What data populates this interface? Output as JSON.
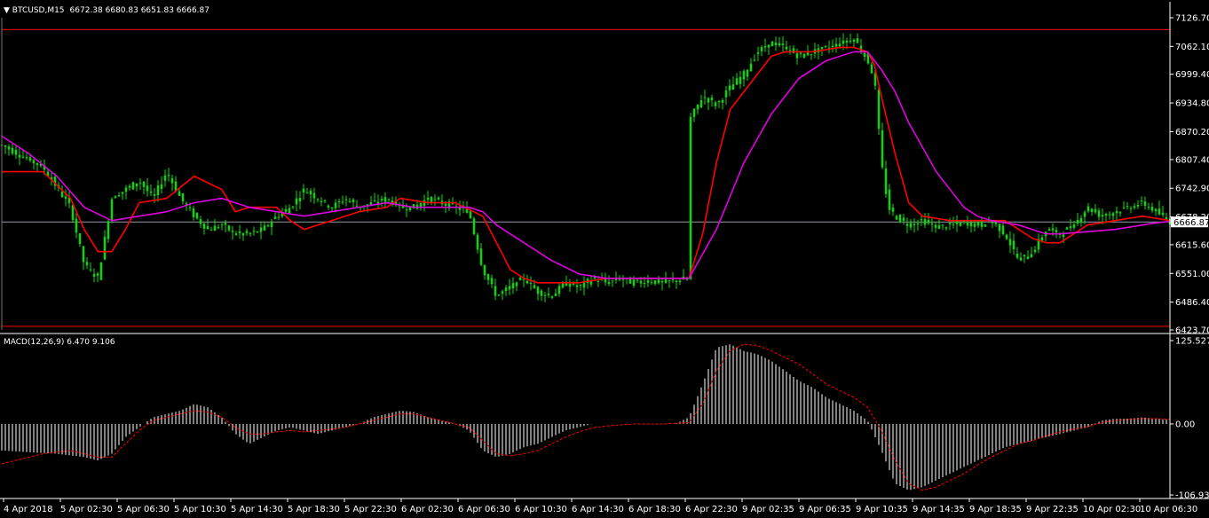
{
  "header": {
    "symbol": "BTCUSD,M15",
    "ohlc": "6672.38 6680.83 6651.83 6666.87"
  },
  "macd_header": "MACD(12,26,9) 6.470 9.106",
  "current_price_label": "6666.87",
  "colors": {
    "background": "#000000",
    "candles": "#00e000",
    "ma_fast": "#ff0000",
    "ma_slow": "#e000e0",
    "hline": "#ff0000",
    "current_line": "#9a9aa8",
    "macd_hist": "#ffffff",
    "macd_signal": "#ff0000",
    "axis_text": "#ffffff"
  },
  "chart_data": [
    {
      "type": "candlestick",
      "title": "BTCUSD,M15",
      "y_ticks": [
        "7126.70",
        "7062.10",
        "6999.40",
        "6934.80",
        "6870.20",
        "6807.40",
        "6742.90",
        "6678.20",
        "6615.60",
        "6551.00",
        "6486.40",
        "6423.70"
      ],
      "ylim": [
        6423.7,
        7126.7
      ],
      "last_price": 6666.87,
      "horizontal_levels": [
        7100,
        6432
      ],
      "x_ticks": [
        "4 Apr 2018",
        "5 Apr 02:30",
        "5 Apr 06:30",
        "5 Apr 10:30",
        "5 Apr 14:30",
        "5 Apr 18:30",
        "5 Apr 22:30",
        "6 Apr 02:30",
        "6 Apr 06:30",
        "6 Apr 10:30",
        "6 Apr 14:30",
        "6 Apr 18:30",
        "6 Apr 22:30",
        "9 Apr 02:35",
        "9 Apr 06:35",
        "9 Apr 10:35",
        "9 Apr 14:35",
        "9 Apr 18:35",
        "9 Apr 22:35",
        "10 Apr 02:30",
        "10 Apr 06:30"
      ],
      "price_path": [
        [
          0,
          6840
        ],
        [
          3,
          6790
        ],
        [
          5,
          6700
        ],
        [
          6,
          6570
        ],
        [
          7,
          6540
        ],
        [
          8,
          6720
        ],
        [
          9,
          6740
        ],
        [
          10,
          6760
        ],
        [
          11,
          6720
        ],
        [
          12,
          6780
        ],
        [
          13,
          6720
        ],
        [
          14,
          6680
        ],
        [
          15,
          6650
        ],
        [
          16,
          6660
        ],
        [
          17,
          6640
        ],
        [
          18,
          6640
        ],
        [
          19,
          6650
        ],
        [
          20,
          6680
        ],
        [
          21,
          6700
        ],
        [
          22,
          6740
        ],
        [
          23,
          6720
        ],
        [
          24,
          6700
        ],
        [
          25,
          6720
        ],
        [
          26,
          6700
        ],
        [
          27,
          6710
        ],
        [
          28,
          6720
        ],
        [
          29,
          6700
        ],
        [
          30,
          6700
        ],
        [
          31,
          6720
        ],
        [
          32,
          6710
        ],
        [
          33,
          6700
        ],
        [
          34,
          6690
        ],
        [
          35,
          6560
        ],
        [
          36,
          6500
        ],
        [
          37,
          6520
        ],
        [
          38,
          6540
        ],
        [
          39,
          6510
        ],
        [
          40,
          6500
        ],
        [
          41,
          6530
        ],
        [
          42,
          6520
        ],
        [
          43,
          6540
        ],
        [
          44,
          6530
        ],
        [
          45,
          6540
        ],
        [
          46,
          6530
        ],
        [
          47,
          6535
        ],
        [
          48,
          6530
        ],
        [
          49,
          6535
        ],
        [
          50,
          6540
        ],
        [
          50.1,
          6900
        ],
        [
          51,
          6950
        ],
        [
          52,
          6930
        ],
        [
          53,
          6970
        ],
        [
          54,
          7000
        ],
        [
          55,
          7050
        ],
        [
          56,
          7070
        ],
        [
          57,
          7060
        ],
        [
          58,
          7040
        ],
        [
          59,
          7050
        ],
        [
          60,
          7060
        ],
        [
          61,
          7070
        ],
        [
          62,
          7080
        ],
        [
          63,
          7030
        ],
        [
          63.5,
          6990
        ],
        [
          64,
          6800
        ],
        [
          64.5,
          6700
        ],
        [
          65,
          6680
        ],
        [
          66,
          6660
        ],
        [
          67,
          6670
        ],
        [
          68,
          6655
        ],
        [
          69,
          6660
        ],
        [
          70,
          6665
        ],
        [
          71,
          6660
        ],
        [
          72,
          6670
        ],
        [
          73,
          6640
        ],
        [
          74,
          6580
        ],
        [
          75,
          6600
        ],
        [
          76,
          6650
        ],
        [
          77,
          6640
        ],
        [
          78,
          6660
        ],
        [
          79,
          6700
        ],
        [
          80,
          6680
        ],
        [
          81,
          6690
        ],
        [
          82,
          6700
        ],
        [
          83,
          6710
        ],
        [
          84,
          6690
        ],
        [
          85,
          6667
        ]
      ],
      "ma_fast": [
        [
          0,
          6780
        ],
        [
          3,
          6780
        ],
        [
          5,
          6720
        ],
        [
          6,
          6650
        ],
        [
          7,
          6600
        ],
        [
          8,
          6600
        ],
        [
          9,
          6650
        ],
        [
          10,
          6710
        ],
        [
          12,
          6720
        ],
        [
          14,
          6770
        ],
        [
          16,
          6740
        ],
        [
          17,
          6690
        ],
        [
          18,
          6700
        ],
        [
          20,
          6700
        ],
        [
          21,
          6670
        ],
        [
          22,
          6650
        ],
        [
          24,
          6670
        ],
        [
          26,
          6690
        ],
        [
          28,
          6700
        ],
        [
          29,
          6720
        ],
        [
          31,
          6710
        ],
        [
          33,
          6710
        ],
        [
          35,
          6680
        ],
        [
          36,
          6620
        ],
        [
          37,
          6560
        ],
        [
          38,
          6540
        ],
        [
          39,
          6530
        ],
        [
          40,
          6530
        ],
        [
          42,
          6530
        ],
        [
          44,
          6540
        ],
        [
          46,
          6540
        ],
        [
          48,
          6540
        ],
        [
          50,
          6540
        ],
        [
          51,
          6640
        ],
        [
          52,
          6800
        ],
        [
          53,
          6920
        ],
        [
          54,
          6960
        ],
        [
          55,
          7000
        ],
        [
          56,
          7040
        ],
        [
          57,
          7050
        ],
        [
          59,
          7050
        ],
        [
          61,
          7060
        ],
        [
          62,
          7060
        ],
        [
          63,
          7050
        ],
        [
          63.5,
          7020
        ],
        [
          64,
          6950
        ],
        [
          65,
          6820
        ],
        [
          66,
          6710
        ],
        [
          67,
          6680
        ],
        [
          69,
          6670
        ],
        [
          71,
          6670
        ],
        [
          73,
          6670
        ],
        [
          74,
          6650
        ],
        [
          75,
          6630
        ],
        [
          76,
          6620
        ],
        [
          77,
          6620
        ],
        [
          78,
          6640
        ],
        [
          79,
          6660
        ],
        [
          81,
          6670
        ],
        [
          83,
          6680
        ],
        [
          85,
          6670
        ]
      ],
      "ma_slow": [
        [
          0,
          6860
        ],
        [
          2,
          6820
        ],
        [
          4,
          6770
        ],
        [
          6,
          6700
        ],
        [
          8,
          6670
        ],
        [
          10,
          6680
        ],
        [
          12,
          6690
        ],
        [
          14,
          6710
        ],
        [
          16,
          6720
        ],
        [
          18,
          6700
        ],
        [
          20,
          6690
        ],
        [
          22,
          6680
        ],
        [
          24,
          6690
        ],
        [
          26,
          6700
        ],
        [
          28,
          6710
        ],
        [
          30,
          6700
        ],
        [
          32,
          6700
        ],
        [
          34,
          6700
        ],
        [
          35,
          6690
        ],
        [
          36,
          6660
        ],
        [
          38,
          6620
        ],
        [
          40,
          6580
        ],
        [
          42,
          6550
        ],
        [
          44,
          6540
        ],
        [
          46,
          6540
        ],
        [
          48,
          6540
        ],
        [
          50,
          6540
        ],
        [
          52,
          6650
        ],
        [
          54,
          6800
        ],
        [
          56,
          6910
        ],
        [
          58,
          6990
        ],
        [
          60,
          7030
        ],
        [
          62,
          7050
        ],
        [
          63,
          7050
        ],
        [
          64,
          7010
        ],
        [
          65,
          6960
        ],
        [
          66,
          6890
        ],
        [
          68,
          6780
        ],
        [
          70,
          6700
        ],
        [
          71,
          6680
        ],
        [
          72,
          6670
        ],
        [
          73,
          6665
        ],
        [
          74,
          6660
        ],
        [
          75,
          6650
        ],
        [
          76,
          6640
        ],
        [
          77,
          6640
        ],
        [
          79,
          6645
        ],
        [
          81,
          6650
        ],
        [
          83,
          6660
        ],
        [
          84,
          6665
        ],
        [
          85,
          6668
        ]
      ]
    },
    {
      "type": "bar",
      "title": "MACD(12,26,9)",
      "y_ticks": [
        "125.527",
        "0.00",
        "-106.938"
      ],
      "ylim": [
        -106.938,
        125.527
      ],
      "histogram": [
        [
          0,
          -40
        ],
        [
          4,
          -45
        ],
        [
          6,
          -50
        ],
        [
          7,
          -55
        ],
        [
          8,
          -45
        ],
        [
          9,
          -20
        ],
        [
          10,
          -5
        ],
        [
          11,
          10
        ],
        [
          12,
          15
        ],
        [
          13,
          20
        ],
        [
          14,
          30
        ],
        [
          15,
          25
        ],
        [
          16,
          10
        ],
        [
          17,
          -15
        ],
        [
          18,
          -30
        ],
        [
          19,
          -20
        ],
        [
          20,
          -10
        ],
        [
          21,
          -5
        ],
        [
          22,
          -10
        ],
        [
          23,
          -15
        ],
        [
          24,
          -10
        ],
        [
          25,
          -5
        ],
        [
          26,
          0
        ],
        [
          27,
          10
        ],
        [
          28,
          15
        ],
        [
          29,
          20
        ],
        [
          30,
          18
        ],
        [
          31,
          10
        ],
        [
          32,
          5
        ],
        [
          33,
          0
        ],
        [
          34,
          -10
        ],
        [
          35,
          -40
        ],
        [
          36,
          -50
        ],
        [
          37,
          -45
        ],
        [
          38,
          -35
        ],
        [
          39,
          -30
        ],
        [
          40,
          -20
        ],
        [
          41,
          -10
        ],
        [
          42,
          -5
        ],
        [
          43,
          0
        ],
        [
          44,
          0
        ],
        [
          45,
          0
        ],
        [
          46,
          0
        ],
        [
          47,
          0
        ],
        [
          48,
          0
        ],
        [
          49,
          0
        ],
        [
          50,
          10
        ],
        [
          51,
          60
        ],
        [
          52,
          115
        ],
        [
          53,
          120
        ],
        [
          54,
          110
        ],
        [
          55,
          105
        ],
        [
          56,
          95
        ],
        [
          57,
          80
        ],
        [
          58,
          65
        ],
        [
          59,
          55
        ],
        [
          60,
          40
        ],
        [
          61,
          30
        ],
        [
          62,
          20
        ],
        [
          63,
          5
        ],
        [
          64,
          -40
        ],
        [
          65,
          -90
        ],
        [
          66,
          -100
        ],
        [
          67,
          -95
        ],
        [
          68,
          -85
        ],
        [
          69,
          -75
        ],
        [
          70,
          -65
        ],
        [
          71,
          -55
        ],
        [
          72,
          -45
        ],
        [
          73,
          -35
        ],
        [
          74,
          -30
        ],
        [
          75,
          -25
        ],
        [
          76,
          -20
        ],
        [
          77,
          -15
        ],
        [
          78,
          -10
        ],
        [
          79,
          -5
        ],
        [
          80,
          5
        ],
        [
          81,
          8
        ],
        [
          82,
          8
        ],
        [
          83,
          10
        ],
        [
          84,
          8
        ],
        [
          85,
          6
        ]
      ],
      "signal": [
        [
          0,
          -60
        ],
        [
          3,
          -45
        ],
        [
          5,
          -40
        ],
        [
          7,
          -50
        ],
        [
          8,
          -50
        ],
        [
          9,
          -30
        ],
        [
          10,
          -10
        ],
        [
          11,
          5
        ],
        [
          12,
          10
        ],
        [
          13,
          15
        ],
        [
          14,
          20
        ],
        [
          15,
          18
        ],
        [
          16,
          10
        ],
        [
          17,
          -5
        ],
        [
          18,
          -15
        ],
        [
          19,
          -15
        ],
        [
          20,
          -12
        ],
        [
          21,
          -10
        ],
        [
          22,
          -12
        ],
        [
          23,
          -10
        ],
        [
          24,
          -8
        ],
        [
          25,
          -5
        ],
        [
          26,
          0
        ],
        [
          27,
          5
        ],
        [
          28,
          10
        ],
        [
          29,
          15
        ],
        [
          30,
          15
        ],
        [
          31,
          10
        ],
        [
          32,
          5
        ],
        [
          33,
          0
        ],
        [
          34,
          -5
        ],
        [
          35,
          -25
        ],
        [
          36,
          -45
        ],
        [
          37,
          -48
        ],
        [
          38,
          -45
        ],
        [
          39,
          -40
        ],
        [
          40,
          -30
        ],
        [
          41,
          -20
        ],
        [
          42,
          -12
        ],
        [
          43,
          -6
        ],
        [
          44,
          -3
        ],
        [
          46,
          0
        ],
        [
          48,
          0
        ],
        [
          50,
          2
        ],
        [
          51,
          30
        ],
        [
          52,
          80
        ],
        [
          53,
          110
        ],
        [
          54,
          120
        ],
        [
          55,
          118
        ],
        [
          56,
          110
        ],
        [
          57,
          100
        ],
        [
          58,
          90
        ],
        [
          59,
          75
        ],
        [
          60,
          60
        ],
        [
          61,
          50
        ],
        [
          62,
          40
        ],
        [
          63,
          25
        ],
        [
          64,
          -10
        ],
        [
          65,
          -55
        ],
        [
          66,
          -90
        ],
        [
          67,
          -100
        ],
        [
          68,
          -95
        ],
        [
          69,
          -85
        ],
        [
          70,
          -75
        ],
        [
          71,
          -62
        ],
        [
          72,
          -50
        ],
        [
          73,
          -40
        ],
        [
          74,
          -30
        ],
        [
          75,
          -25
        ],
        [
          76,
          -18
        ],
        [
          77,
          -12
        ],
        [
          78,
          -8
        ],
        [
          79,
          -4
        ],
        [
          80,
          2
        ],
        [
          81,
          5
        ],
        [
          82,
          7
        ],
        [
          83,
          8
        ],
        [
          84,
          8
        ],
        [
          85,
          7
        ]
      ]
    }
  ]
}
